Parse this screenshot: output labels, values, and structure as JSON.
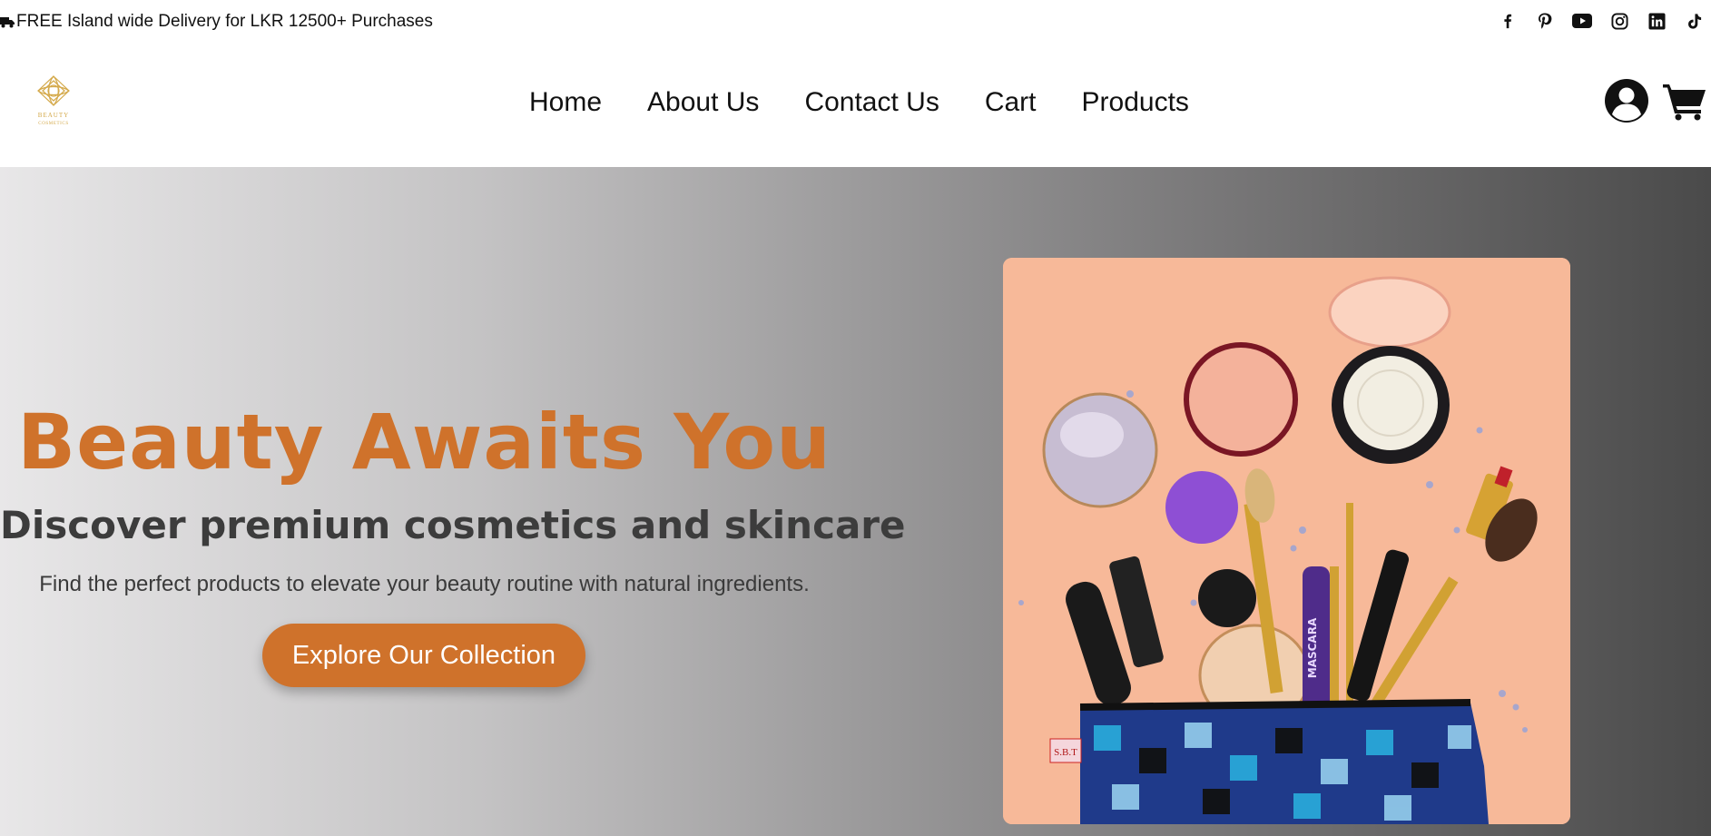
{
  "topbar": {
    "promo_text": "FREE Island wide Delivery for LKR 12500+ Purchases",
    "promo_icon": "truck-icon",
    "social_icons": [
      "facebook-icon",
      "pinterest-icon",
      "youtube-icon",
      "instagram-icon",
      "linkedin-icon",
      "tiktok-icon"
    ]
  },
  "header": {
    "logo_line1": "BEAUTY",
    "logo_line2": "COSMETICS",
    "nav": {
      "home": "Home",
      "about": "About Us",
      "contact": "Contact Us",
      "cart": "Cart",
      "products": "Products"
    },
    "actions": [
      "user-account-icon",
      "shopping-cart-icon"
    ]
  },
  "hero": {
    "title": "Beauty Awaits You",
    "subtitle": "Discover premium cosmetics and skincare",
    "description": "Find the perfect products to elevate your beauty routine with natural ingredients.",
    "cta_label": "Explore Our Collection",
    "image_pouch_tag": "S.B.T",
    "image_product_label": "MASCARA"
  },
  "colors": {
    "accent": "#cf722b",
    "logo_gold": "#d4a94a",
    "hero_gradient_start": "#e8e7e8",
    "hero_gradient_end": "#4a4a4a",
    "image_bg": "#f6b99a"
  }
}
